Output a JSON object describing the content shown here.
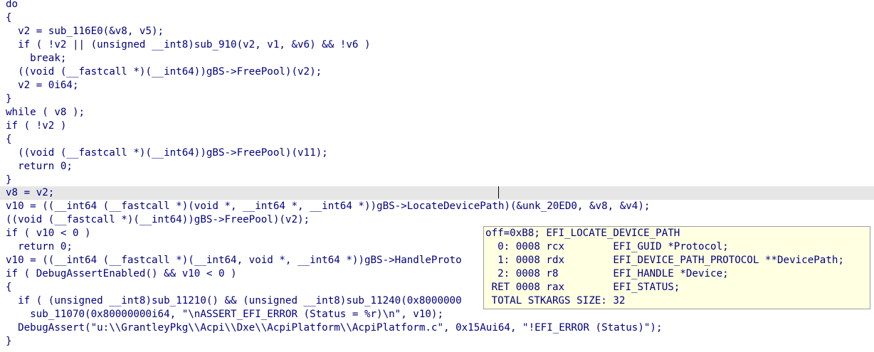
{
  "code_lines": [
    {
      "text": "do"
    },
    {
      "text": "{"
    },
    {
      "text": "  v2 = sub_116E0(&v8, v5);"
    },
    {
      "text": "  if ( !v2 || (unsigned __int8)sub_910(v2, v1, &v6) && !v6 )"
    },
    {
      "text": "    break;"
    },
    {
      "text": "  ((void (__fastcall *)(__int64))gBS->FreePool)(v2);"
    },
    {
      "text": "  v2 = 0i64;"
    },
    {
      "text": "}"
    },
    {
      "text": "while ( v8 );"
    },
    {
      "text": "if ( !v2 )"
    },
    {
      "text": "{"
    },
    {
      "text": "  ((void (__fastcall *)(__int64))gBS->FreePool)(v11);"
    },
    {
      "text": "  return 0;"
    },
    {
      "text": "}"
    },
    {
      "text": "v8 = v2;"
    },
    {
      "text": "v10 = ((__int64 (__fastcall *)(void *, __int64 *, __int64 *))gBS->LocateDevicePath)(&unk_20ED0, &v8, &v4);"
    },
    {
      "text": "((void (__fastcall *)(__int64))gBS->FreePool)(v2);"
    },
    {
      "text": "if ( v10 < 0 )"
    },
    {
      "text": "  return 0;"
    },
    {
      "text": "v10 = ((__int64 (__fastcall *)(__int64, void *, __int64 *))gBS->HandleProto"
    },
    {
      "text": "if ( DebugAssertEnabled() && v10 < 0 )"
    },
    {
      "text": "{"
    },
    {
      "text": "  if ( (unsigned __int8)sub_11210() && (unsigned __int8)sub_11240(0x8000000"
    },
    {
      "text": "    sub_11070(0x80000000i64, \"\\nASSERT_EFI_ERROR (Status = %r)\\n\", v10);"
    },
    {
      "text": "  DebugAssert(\"u:\\\\GrantleyPkg\\\\Acpi\\\\Dxe\\\\AcpiPlatform\\\\AcpiPlatform.c\", 0x15Aui64, \"!EFI_ERROR (Status)\");"
    },
    {
      "text": "}"
    }
  ],
  "hint_lines": [
    {
      "text": "off=0xB8; EFI_LOCATE_DEVICE_PATH"
    },
    {
      "text": "  0: 0008 rcx        EFI_GUID *Protocol;"
    },
    {
      "text": "  1: 0008 rdx        EFI_DEVICE_PATH_PROTOCOL **DevicePath;"
    },
    {
      "text": "  2: 0008 r8         EFI_HANDLE *Device;"
    },
    {
      "text": " RET 0008 rax        EFI_STATUS;"
    },
    {
      "text": " TOTAL STKARGS SIZE: 32"
    }
  ],
  "colors": {
    "code_text": "#000080",
    "variable": "#7d84c7",
    "highlight_line": "#e6e6e6",
    "hint_background": "#ffffe1",
    "hint_border": "#9e9e9e"
  }
}
